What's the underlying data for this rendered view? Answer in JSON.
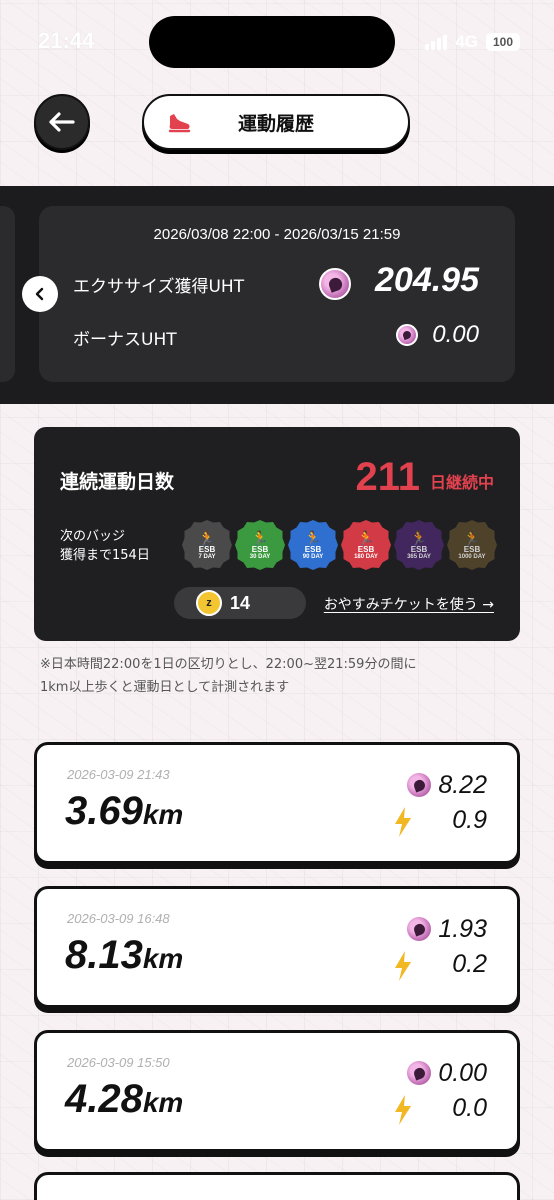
{
  "status_bar": {
    "time": "21:44",
    "network": "4G",
    "battery": "100"
  },
  "header": {
    "title": "運動履歴"
  },
  "summary": {
    "period": "2026/03/08 22:00 - 2026/03/15 21:59",
    "exercise_label": "エクササイズ獲得UHT",
    "exercise_value": "204.95",
    "bonus_label": "ボーナスUHT",
    "bonus_value": "0.00"
  },
  "streak": {
    "title": "連続運動日数",
    "days": "211",
    "suffix": "日継続中",
    "next_badge_line1": "次のバッジ",
    "next_badge_line2": "獲得まで154日",
    "badges": [
      {
        "esb": "ESB",
        "day": "7 DAY",
        "color": "#4a4a4a"
      },
      {
        "esb": "ESB",
        "day": "30 DAY",
        "color": "#3b9a3f"
      },
      {
        "esb": "ESB",
        "day": "90 DAY",
        "color": "#2f6fcf"
      },
      {
        "esb": "ESB",
        "day": "180 DAY",
        "color": "#d23b45"
      },
      {
        "esb": "ESB",
        "day": "365 DAY",
        "color": "#4b2a6e"
      },
      {
        "esb": "ESB",
        "day": "1000 DAY",
        "color": "#5a4b2e"
      }
    ],
    "ticket_count": "14",
    "use_ticket": "おやすみチケットを使う →"
  },
  "note": {
    "line1": "※日本時間22:00を1日の区切りとし、22:00~翌21:59分の間に",
    "line2": "1km以上歩くと運動日として計測されます"
  },
  "activities": [
    {
      "datetime": "2026-03-09 21:43",
      "distance": "3.69",
      "unit": "km",
      "uht": "8.22",
      "energy": "0.9"
    },
    {
      "datetime": "2026-03-09 16:48",
      "distance": "8.13",
      "unit": "km",
      "uht": "1.93",
      "energy": "0.2"
    },
    {
      "datetime": "2026-03-09 15:50",
      "distance": "4.28",
      "unit": "km",
      "uht": "0.00",
      "energy": "0.0"
    }
  ],
  "colors": {
    "streak_red": "#e2414e",
    "bolt_yellow": "#f2b824",
    "coin_pink": "#c978bd"
  }
}
